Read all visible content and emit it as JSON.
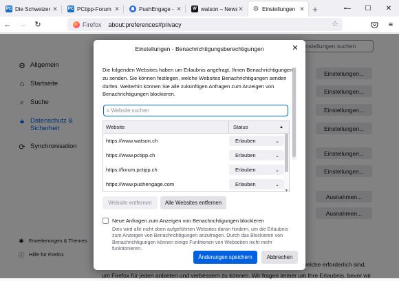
{
  "browser": {
    "tabs": [
      {
        "title": "Die Schweizer Plat",
        "favicon": "PC",
        "favicon_color": "#1f6fbf",
        "active": false
      },
      {
        "title": "PCtipp-Forum",
        "favicon": "PC",
        "favicon_color": "#1f6fbf",
        "active": false
      },
      {
        "title": "PushEngage - The",
        "favicon": "",
        "favicon_color": "#2a6be0",
        "active": false
      },
      {
        "title": "watson – News ohn",
        "favicon": "W",
        "favicon_color": "#15141a",
        "active": false
      },
      {
        "title": "Einstellungen",
        "favicon": "⚙",
        "favicon_color": "#5b5b66",
        "active": true
      }
    ],
    "new_tab_icon": "plus-icon",
    "url_brand": "Firefox",
    "url": "about:preferences#privacy"
  },
  "prefs": {
    "search_placeholder": "nstellungen suchen",
    "sidebar": [
      {
        "label": "Allgemein",
        "icon": "gear-icon"
      },
      {
        "label": "Startseite",
        "icon": "home-icon"
      },
      {
        "label": "Suche",
        "icon": "search-icon"
      },
      {
        "label": "Datenschutz & Sicherheit",
        "icon": "lock-icon",
        "selected": true
      },
      {
        "label": "Synchronisation",
        "icon": "sync-icon"
      }
    ],
    "sidebar_bottom": [
      {
        "label": "Erweiterungen & Themes",
        "icon": "puzzle-icon"
      },
      {
        "label": "Hilfe für Firefox",
        "icon": "help-icon"
      }
    ],
    "buttons": [
      "Einstellungen...",
      "Einstellungen...",
      "Einstellungen...",
      "Einstellungen...",
      "Einstellungen...",
      "Einstellungen...",
      "Ausnahmen...",
      "Ausnahmen..."
    ],
    "footer_line1": "welche erforderlich sind,",
    "footer_line2": "um Firefox für jeden anbieten und verbessern zu können. Wir fragen immer um Ihre Erlaubnis, bevor wir"
  },
  "dialog": {
    "title": "Einstellungen - Benachrichtigungsberechtigungen",
    "description": "Die folgenden Websites haben um Erlaubnis angefragt, Ihnen Benachrichtigungen zu senden. Sie können festlegen, welche Websites Benachrichtigungen senden dürfen. Weiterhin können Sie alle zukünftigen Anfragen zum Anzeigen von Benachrichtigungen blockieren.",
    "search_placeholder": "Website suchen",
    "col_website": "Website",
    "col_status": "Status",
    "rows": [
      {
        "site": "https://www.watson.ch",
        "status": "Erlauben"
      },
      {
        "site": "https://www.pctipp.ch",
        "status": "Erlauben"
      },
      {
        "site": "https://forum.pctipp.ch",
        "status": "Erlauben"
      },
      {
        "site": "https://www.pushengage.com",
        "status": "Erlauben"
      }
    ],
    "remove_site": "Website entfernen",
    "remove_all": "Alle Websites entfernen",
    "block_label": "Neue Anfragen zum Anzeigen von Benachrichtigungen blockieren",
    "block_desc": "Dies wird alle nicht oben aufgeführten Websites daran hindern, um die Erlaubnis zum Anzeigen von Benachrichtigungen anzufragen. Durch das Blockieren von Benachrichtigungen können einige Funktionen von Webseiten nicht mehr funktionieren.",
    "save": "Änderungen speichern",
    "cancel": "Abbrechen"
  }
}
